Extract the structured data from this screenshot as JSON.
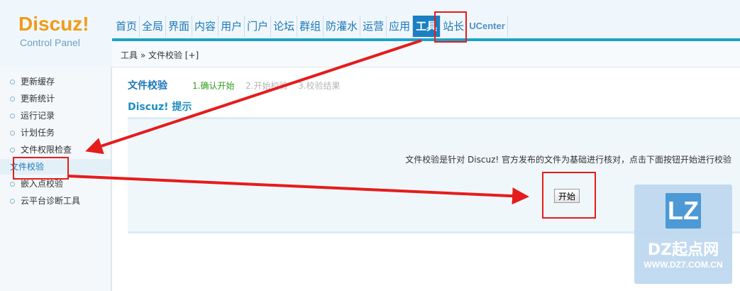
{
  "logo": {
    "brand": "Discuz!",
    "subtitle": "Control Panel"
  },
  "nav": {
    "items": [
      {
        "label": "首页"
      },
      {
        "label": "全局"
      },
      {
        "label": "界面"
      },
      {
        "label": "内容"
      },
      {
        "label": "用户"
      },
      {
        "label": "门户"
      },
      {
        "label": "论坛"
      },
      {
        "label": "群组"
      },
      {
        "label": "防灌水"
      },
      {
        "label": "运营"
      },
      {
        "label": "应用"
      },
      {
        "label": "工具"
      },
      {
        "label": "站长"
      },
      {
        "label": "UCenter"
      }
    ],
    "active": "工具"
  },
  "breadcrumb": {
    "text": "工具 » 文件校验  [+]"
  },
  "sidebar": {
    "items": [
      {
        "label": "更新缓存"
      },
      {
        "label": "更新统计"
      },
      {
        "label": "运行记录"
      },
      {
        "label": "计划任务"
      },
      {
        "label": "文件权限检查"
      },
      {
        "label": "文件校验"
      },
      {
        "label": "嵌入点校验"
      },
      {
        "label": "云平台诊断工具"
      }
    ],
    "active": "文件校验"
  },
  "main": {
    "title": "文件校验",
    "steps": [
      {
        "label": "1.确认开始",
        "color": "#2e9c1a"
      },
      {
        "label": "2.开始校验",
        "color": "#b5b5b5"
      },
      {
        "label": "3.校验结果",
        "color": "#b5b5b5"
      }
    ],
    "tip_title": "Discuz! 提示",
    "tip_text": "文件校验是针对 Discuz! 官方发布的文件为基础进行核对，点击下面按钮开始进行校验",
    "start_button": "开始"
  },
  "watermark": {
    "logo": "LZ",
    "site": "DZ起点网",
    "url": "WWW.DZ7.COM.CN"
  },
  "colors": {
    "accent": "#1b7fc1",
    "highlight": "#e51c1c",
    "logo": "#f19b18"
  }
}
